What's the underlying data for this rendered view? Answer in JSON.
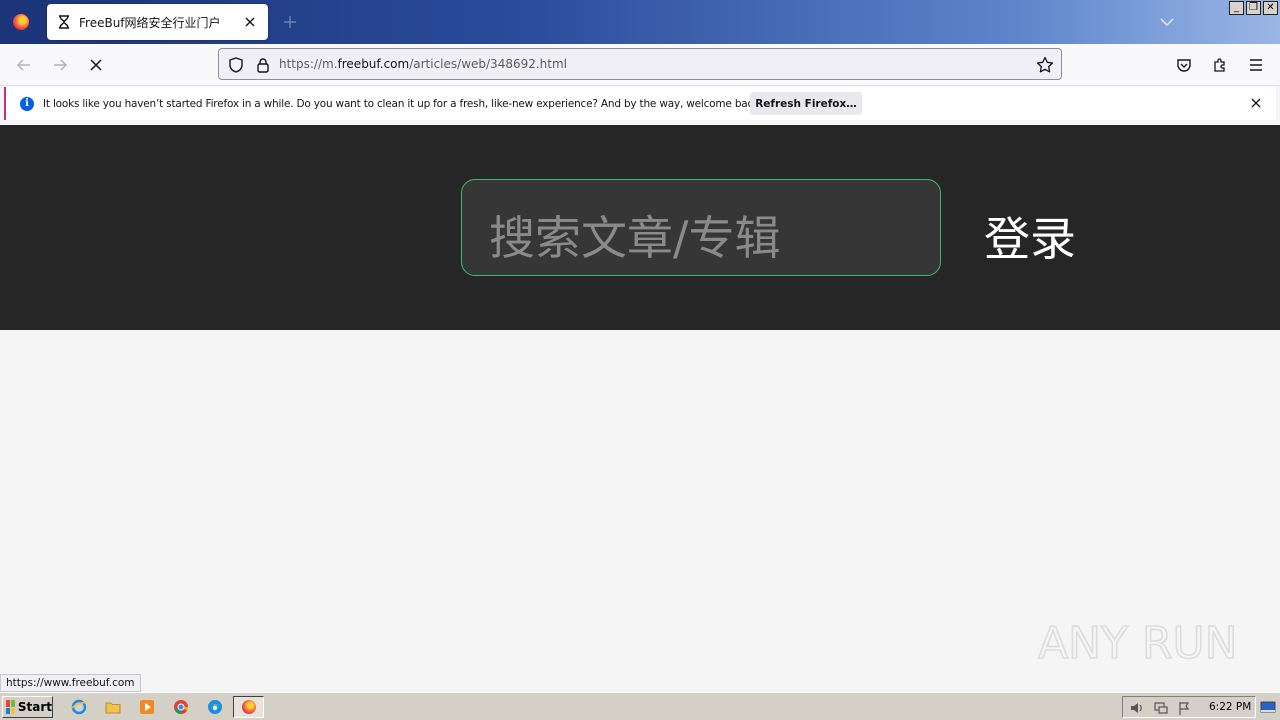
{
  "browser": {
    "tab": {
      "title": "FreeBuf网络安全行业门户",
      "icon": "hourglass-icon"
    },
    "url": {
      "prefix": "https://m.",
      "host": "freebuf.com",
      "path": "/articles/web/348692.html"
    },
    "window_controls": {
      "minimize": "_",
      "restore": "❐",
      "close": "✕"
    }
  },
  "notification": {
    "message": "It looks like you haven’t started Firefox in a while. Do you want to clean it up for a fresh, like-new experience? And by the way, welcome back!",
    "button_label": "Refresh Firefox…"
  },
  "page": {
    "search_placeholder": "搜索文章/专辑",
    "login_label": "登录",
    "header_bg": "#262626",
    "search_border": "#3cba6a"
  },
  "status_bar": {
    "link": "https://www.freebuf.com"
  },
  "taskbar": {
    "start_label": "Start",
    "quick_launch": [
      "ie-icon",
      "folder-icon",
      "media-player-icon",
      "chrome-icon",
      "edge-icon",
      "firefox-icon"
    ],
    "clock": "6:22 PM"
  },
  "watermark": {
    "text": "ANY RUN"
  }
}
